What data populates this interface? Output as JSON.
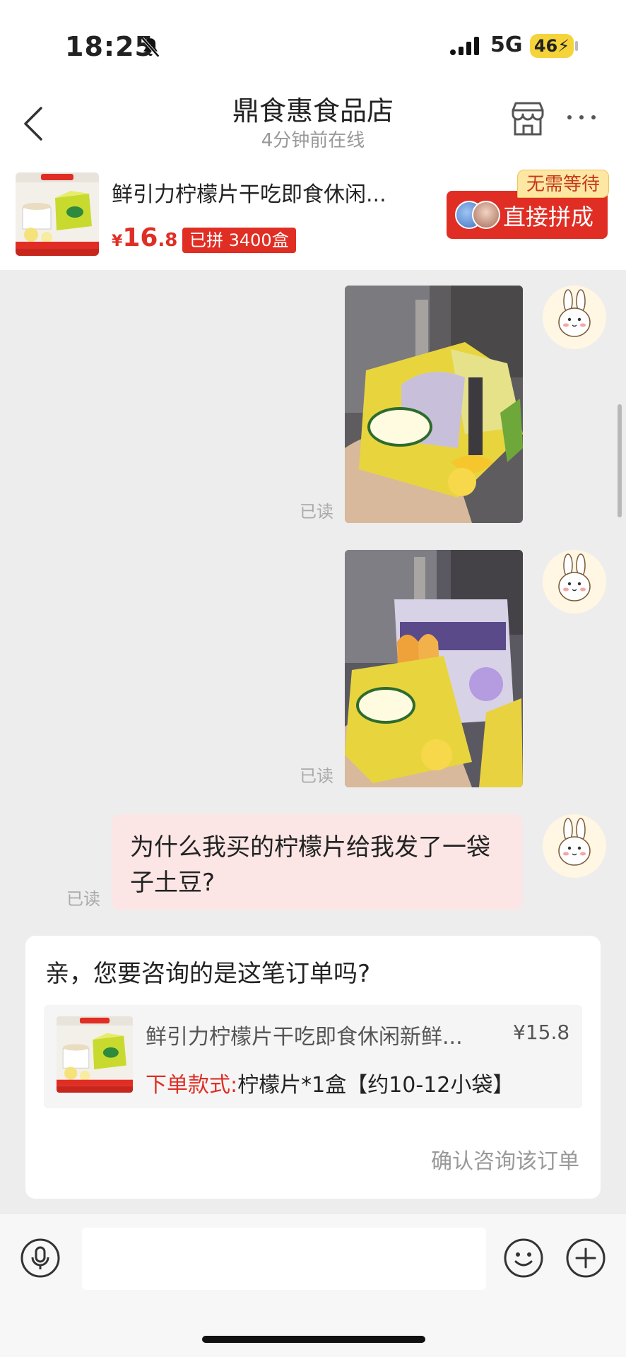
{
  "status_bar": {
    "time": "18:25",
    "network": "5G",
    "battery": "46"
  },
  "header": {
    "shop_name": "鼎食惠食品店",
    "online_status": "4分钟前在线"
  },
  "product": {
    "title": "鲜引力柠檬片干吃即食休闲...",
    "price_currency": "¥",
    "price_int": "16",
    "price_dec": ".8",
    "sold": "已拼 3400盒",
    "no_wait": "无需等待",
    "join_label": "直接拼成"
  },
  "messages": [
    {
      "type": "image",
      "read": "已读"
    },
    {
      "type": "image",
      "read": "已读"
    },
    {
      "type": "text",
      "text": "为什么我买的柠檬片给我发了一袋子土豆?",
      "read": "已读"
    }
  ],
  "order_card": {
    "question": "亲，您要咨询的是这笔订单吗?",
    "title": "鲜引力柠檬片干吃即食休闲新鲜...",
    "price": "¥15.8",
    "spec_key": "下单款式:",
    "spec_value": "柠檬片*1盒【约10-12小袋】",
    "confirm": "确认咨询该订单"
  },
  "input": {
    "placeholder": ""
  },
  "colors": {
    "accent": "#e02e24",
    "bubble": "#fbe6e5",
    "bg": "#ededed"
  }
}
